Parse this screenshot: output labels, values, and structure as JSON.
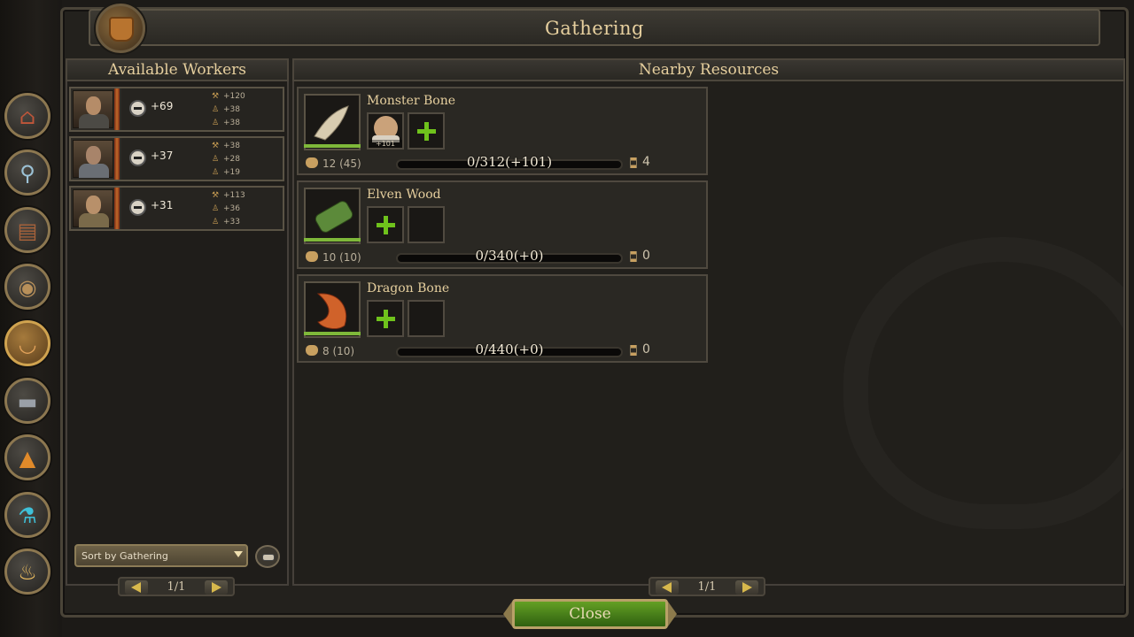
{
  "title": "Gathering",
  "workers_panel": {
    "heading": "Available Workers",
    "workers": [
      {
        "total": "+69",
        "stats": [
          "+120",
          "+38",
          "+38"
        ]
      },
      {
        "total": "+37",
        "stats": [
          "+38",
          "+28",
          "+19"
        ]
      },
      {
        "total": "+31",
        "stats": [
          "+113",
          "+36",
          "+33"
        ]
      }
    ],
    "sort_label": "Sort by Gathering",
    "pager": "1/1"
  },
  "resources_panel": {
    "heading": "Nearby Resources",
    "resources": [
      {
        "name": "Monster Bone",
        "quantity": "12 (45)",
        "progress": "0/312(+101)",
        "time": "4",
        "assigned_worker_value": "+101"
      },
      {
        "name": "Elven Wood",
        "quantity": "10 (10)",
        "progress": "0/340(+0)",
        "time": "0"
      },
      {
        "name": "Dragon Bone",
        "quantity": "8 (10)",
        "progress": "0/440(+0)",
        "time": "0"
      }
    ],
    "pager": "1/1"
  },
  "close_label": "Close",
  "colors": {
    "accent_green": "#6fc21c",
    "title_gold": "#e6cf9e"
  }
}
